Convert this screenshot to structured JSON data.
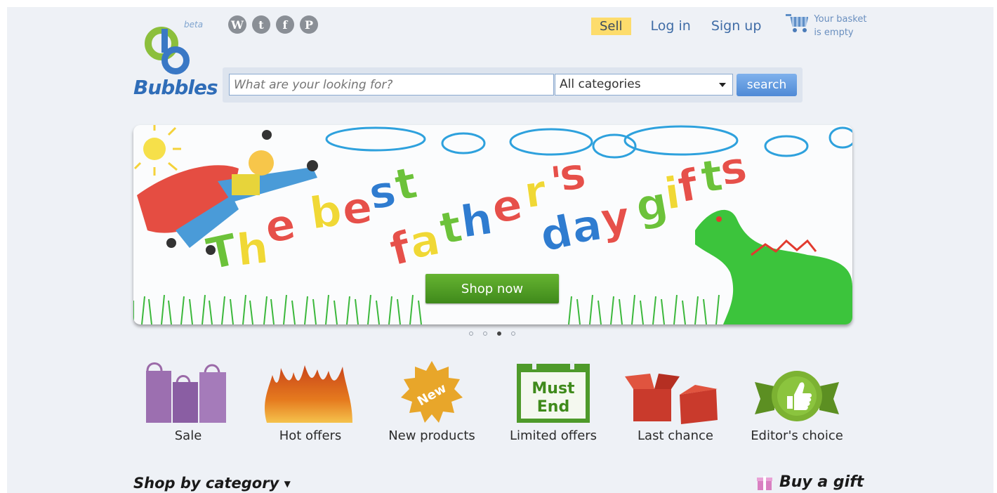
{
  "header": {
    "logo_text": "Bubbles",
    "logo_badge": "beta",
    "social_icons": [
      "wordpress-icon",
      "twitter-icon",
      "facebook-icon",
      "pinterest-icon"
    ],
    "sell_label": "Sell",
    "login_label": "Log in",
    "signup_label": "Sign up",
    "basket_line1": "Your basket",
    "basket_line2": "is empty"
  },
  "search": {
    "placeholder": "What are your looking for?",
    "category_selected": "All categories",
    "button_label": "search"
  },
  "banner": {
    "headline": "The best father's day gifts",
    "cta_label": "Shop now",
    "slide_count": 4,
    "active_slide": 3
  },
  "promos": [
    {
      "label": "Sale",
      "icon": "shopping-bags-icon"
    },
    {
      "label": "Hot offers",
      "icon": "flames-icon"
    },
    {
      "label": "New products",
      "icon": "new-burst-icon",
      "badge": "New"
    },
    {
      "label": "Limited offers",
      "icon": "calendar-icon",
      "badge_line1": "Must",
      "badge_line2": "End"
    },
    {
      "label": "Last chance",
      "icon": "open-boxes-icon"
    },
    {
      "label": "Editor's choice",
      "icon": "thumbs-up-badge-icon"
    }
  ],
  "footer_bar": {
    "shop_by_category": "Shop by category",
    "buy_a_gift": "Buy a gift"
  },
  "colors": {
    "brand_blue": "#2f6db8",
    "brand_green": "#8cbf3c",
    "sell_bg": "#fddc6c",
    "cta_green": "#4f9e23",
    "search_button": "#5f96dd"
  }
}
